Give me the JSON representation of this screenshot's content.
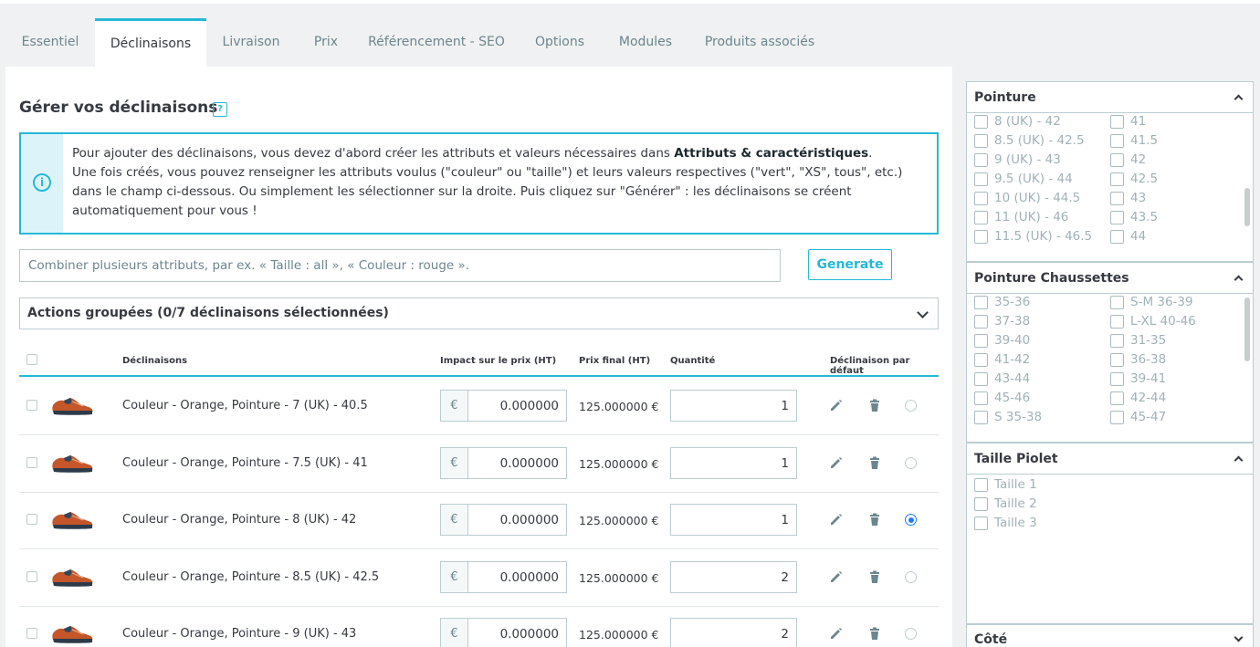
{
  "tabs": [
    {
      "label": "Essentiel"
    },
    {
      "label": "Déclinaisons"
    },
    {
      "label": "Livraison"
    },
    {
      "label": "Prix"
    },
    {
      "label": "Référencement - SEO"
    },
    {
      "label": "Options"
    },
    {
      "label": "Modules"
    },
    {
      "label": "Produits associés"
    }
  ],
  "section": {
    "title": "Gérer vos déclinaisons",
    "help": "?"
  },
  "alert": {
    "line1_pre": "Pour ajouter des déclinaisons, vous devez d'abord créer les attributs et valeurs nécessaires dans ",
    "line1_link": "Attributs & caractéristiques",
    "line1_post": ".",
    "line2": "Une fois créés, vous pouvez renseigner les attributs voulus (\"couleur\" ou \"taille\") et leurs valeurs respectives (\"vert\", \"XS\", tous\", etc.) dans le champ ci-dessous. Ou simplement les sélectionner sur la droite. Puis cliquez sur \"Générer\" : les déclinaisons se créent automatiquement pour vous !"
  },
  "combine": {
    "placeholder": "Combiner plusieurs attributs, par ex. « Taille : all », « Couleur : rouge ».",
    "button": "Generate"
  },
  "bulk": {
    "label": "Actions groupées (0/7 déclinaisons sélectionnées)"
  },
  "table": {
    "headers": {
      "name": "Déclinaisons",
      "impact": "Impact sur le prix (HT)",
      "final": "Prix final (HT)",
      "qty": "Quantité",
      "default": "Déclinaison par défaut"
    },
    "currency": "€",
    "rows": [
      {
        "name": "Couleur - Orange, Pointure - 7 (UK) - 40.5",
        "impact": "0.000000",
        "final": "125.000000 €",
        "qty": "1",
        "default": false
      },
      {
        "name": "Couleur - Orange, Pointure - 7.5 (UK) - 41",
        "impact": "0.000000",
        "final": "125.000000 €",
        "qty": "1",
        "default": false
      },
      {
        "name": "Couleur - Orange, Pointure - 8 (UK) - 42",
        "impact": "0.000000",
        "final": "125.000000 €",
        "qty": "1",
        "default": true
      },
      {
        "name": "Couleur - Orange, Pointure - 8.5 (UK) - 42.5",
        "impact": "0.000000",
        "final": "125.000000 €",
        "qty": "2",
        "default": false
      },
      {
        "name": "Couleur - Orange, Pointure - 9 (UK) - 43",
        "impact": "0.000000",
        "final": "125.000000 €",
        "qty": "2",
        "default": false
      }
    ]
  },
  "panels": {
    "pointure": {
      "title": "Pointure",
      "left": [
        "8 (UK) - 42",
        "8.5 (UK) - 42.5",
        "9 (UK) - 43",
        "9.5 (UK) - 44",
        "10 (UK) - 44.5",
        "11 (UK) - 46",
        "11.5 (UK) - 46.5"
      ],
      "right": [
        "41",
        "41.5",
        "42",
        "42.5",
        "43",
        "43.5",
        "44"
      ]
    },
    "chaussettes": {
      "title": "Pointure Chaussettes",
      "left": [
        "35-36",
        "37-38",
        "39-40",
        "41-42",
        "43-44",
        "45-46",
        "S 35-38"
      ],
      "right": [
        "S-M 36-39",
        "L-XL 40-46",
        "31-35",
        "36-38",
        "39-41",
        "42-44",
        "45-47"
      ]
    },
    "piolet": {
      "title": "Taille Piolet",
      "left": [
        "Taille 1",
        "Taille 2",
        "Taille 3"
      ]
    },
    "cote": {
      "title": "Côté"
    }
  }
}
